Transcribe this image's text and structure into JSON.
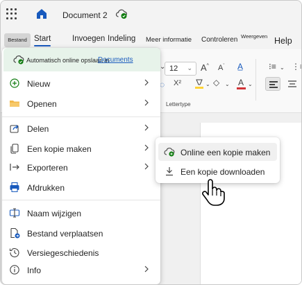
{
  "window": {
    "doc_title": "Document 2"
  },
  "ribbon_tabs": {
    "file": "Bestand",
    "start": "Start",
    "insert": "Invoegen",
    "layout": "Indeling",
    "more_info": "Meer informatie",
    "review": "Controleren",
    "view": "Weergeven",
    "help": "Help"
  },
  "ribbon": {
    "font_size": "12",
    "font_group_label": "Lettertype",
    "grow_font": "A",
    "shrink_font": "A",
    "superscript": "X²",
    "font_color": "A"
  },
  "file_menu": {
    "autosave_label": "Automatisch online opslaan in",
    "autosave_link": "Documents",
    "items": [
      {
        "label": "Nieuw",
        "icon": "plus-circle-icon",
        "has_submenu": true
      },
      {
        "label": "Openen",
        "icon": "folder-icon",
        "has_submenu": true
      },
      {
        "label": "Delen",
        "icon": "share-icon",
        "has_submenu": true
      },
      {
        "label": "Een kopie maken",
        "icon": "copy-icon",
        "has_submenu": true
      },
      {
        "label": "Exporteren",
        "icon": "export-icon",
        "has_submenu": true
      },
      {
        "label": "Afdrukken",
        "icon": "printer-icon",
        "has_submenu": false
      },
      {
        "label": "Naam wijzigen",
        "icon": "rename-icon",
        "has_submenu": false
      },
      {
        "label": "Bestand verplaatsen",
        "icon": "move-file-icon",
        "has_submenu": false
      },
      {
        "label": "Versiegeschiedenis",
        "icon": "history-icon",
        "has_submenu": false
      },
      {
        "label": "Info",
        "icon": "info-icon",
        "has_submenu": true
      }
    ]
  },
  "copy_submenu": {
    "items": [
      {
        "label": "Online een kopie maken",
        "icon": "cloud-copy-icon"
      },
      {
        "label": "Een kopie downloaden",
        "icon": "download-icon"
      }
    ]
  },
  "colors": {
    "accent": "#185abd",
    "autosave_bg": "#e7f3ea",
    "folder": "#f2b84b",
    "printer": "#185abd",
    "font_color_bar": "#d13438",
    "highlight_bar": "#ffd335"
  }
}
